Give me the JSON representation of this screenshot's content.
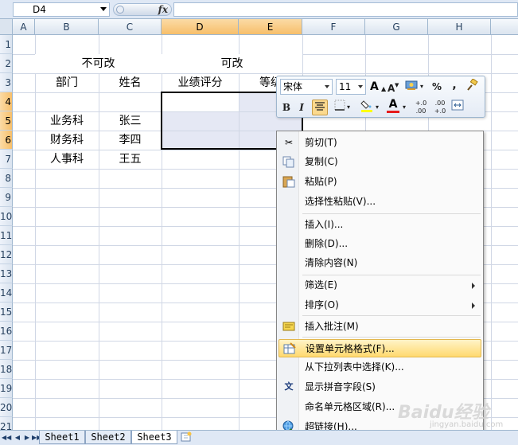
{
  "formula_bar": {
    "cell_ref": "D4",
    "fx": "fx",
    "formula": ""
  },
  "columns": [
    "A",
    "B",
    "C",
    "D",
    "E",
    "F",
    "G",
    "H"
  ],
  "rows": [
    "1",
    "2",
    "3",
    "4",
    "5",
    "6",
    "7",
    "8",
    "9",
    "10",
    "11",
    "12",
    "13",
    "14",
    "15",
    "16",
    "17",
    "18",
    "19",
    "20",
    "21"
  ],
  "cells": {
    "b2": "不可改",
    "d2": "可改",
    "b3": "部门",
    "c3": "姓名",
    "d3": "业绩评分",
    "e3": "等级",
    "b4": "业务科",
    "c4": "张三",
    "b5": "财务科",
    "c5": "李四",
    "b6": "人事科",
    "c6": "王五"
  },
  "mini_toolbar": {
    "font": "宋体",
    "size": "11",
    "grow_font": "A",
    "shrink_font": "A",
    "percent": "%",
    "comma": ",",
    "bold": "B",
    "italic": "I",
    "font_color_letter": "A",
    "inc_decimal": "+.0 .00",
    "dec_decimal": ".00 +.0"
  },
  "context_menu": {
    "items": [
      {
        "label": "剪切(T)",
        "icon": "scissors-icon"
      },
      {
        "label": "复制(C)",
        "icon": "copy-icon"
      },
      {
        "label": "粘贴(P)",
        "icon": "paste-icon"
      },
      {
        "label": "选择性粘贴(V)...",
        "icon": ""
      },
      {
        "label": "插入(I)...",
        "icon": ""
      },
      {
        "label": "删除(D)...",
        "icon": ""
      },
      {
        "label": "清除内容(N)",
        "icon": ""
      },
      {
        "label": "筛选(E)",
        "icon": "",
        "submenu": true
      },
      {
        "label": "排序(O)",
        "icon": "",
        "submenu": true
      },
      {
        "label": "插入批注(M)",
        "icon": "comment-icon"
      },
      {
        "label": "设置单元格格式(F)...",
        "icon": "format-cells-icon",
        "highlighted": true
      },
      {
        "label": "从下拉列表中选择(K)...",
        "icon": ""
      },
      {
        "label": "显示拼音字段(S)",
        "icon": "phonetic-icon"
      },
      {
        "label": "命名单元格区域(R)...",
        "icon": ""
      },
      {
        "label": "超链接(H)...",
        "icon": "hyperlink-icon"
      }
    ]
  },
  "sheet_tabs": [
    "Sheet1",
    "Sheet2",
    "Sheet3"
  ],
  "active_sheet": "Sheet3",
  "watermark": {
    "brand": "Baidu经验",
    "url": "jingyan.baidu.com"
  }
}
